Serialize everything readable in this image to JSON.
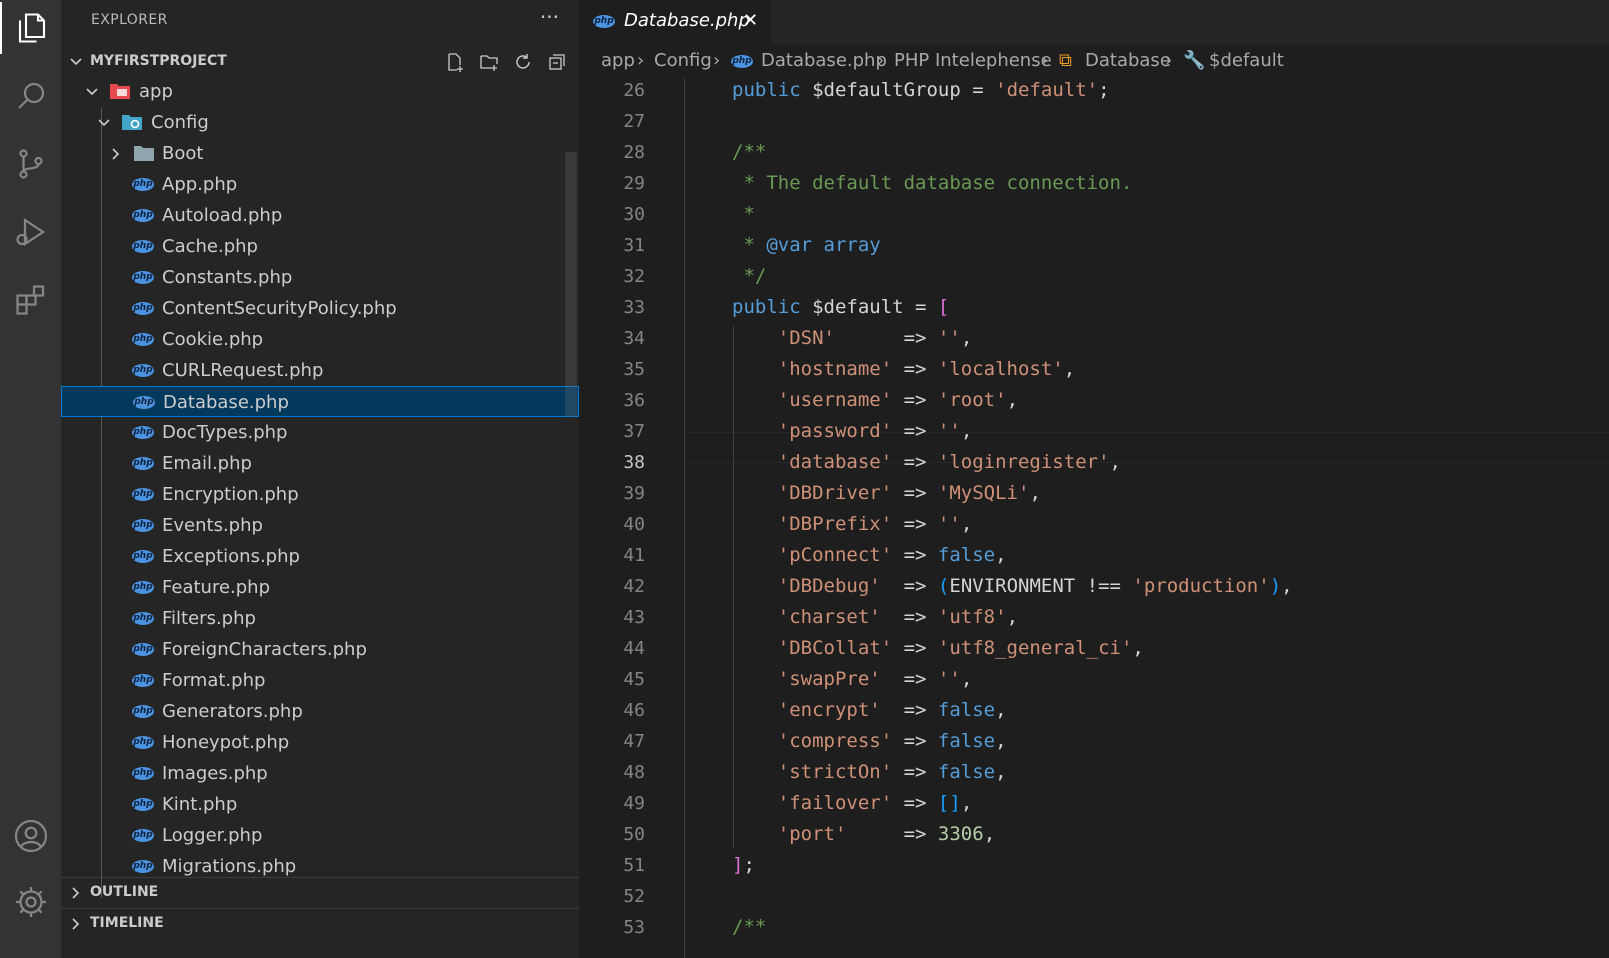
{
  "sidebar": {
    "title": "EXPLORER",
    "more": "···",
    "project": "MYFIRSTPROJECT",
    "tree": {
      "app": "app",
      "config": "Config",
      "boot": "Boot",
      "files": [
        "App.php",
        "Autoload.php",
        "Cache.php",
        "Constants.php",
        "ContentSecurityPolicy.php",
        "Cookie.php",
        "CURLRequest.php",
        "Database.php",
        "DocTypes.php",
        "Email.php",
        "Encryption.php",
        "Events.php",
        "Exceptions.php",
        "Feature.php",
        "Filters.php",
        "ForeignCharacters.php",
        "Format.php",
        "Generators.php",
        "Honeypot.php",
        "Images.php",
        "Kint.php",
        "Logger.php",
        "Migrations.php"
      ],
      "selected": "Database.php"
    },
    "outline": "OUTLINE",
    "timeline": "TIMELINE"
  },
  "tab": {
    "label": "Database.php",
    "close": "✕",
    "icon_text": "php"
  },
  "breadcrumb": [
    "app",
    "Config",
    "Database.php",
    "PHP Intelephense",
    "Database",
    "$default"
  ],
  "editor": {
    "line_numbers": [
      "26",
      "27",
      "28",
      "29",
      "30",
      "31",
      "32",
      "33",
      "34",
      "35",
      "36",
      "37",
      "38",
      "39",
      "40",
      "41",
      "42",
      "43",
      "44",
      "45",
      "46",
      "47",
      "48",
      "49",
      "50",
      "51",
      "52",
      "53"
    ],
    "active_line": "38",
    "code_lines": [
      [
        [
          "k",
          "public"
        ],
        [
          "v",
          " $defaultGroup"
        ],
        [
          "p",
          " = "
        ],
        [
          "s",
          "'default'"
        ],
        [
          "p",
          ";"
        ]
      ],
      [],
      [
        [
          "cm",
          "/**"
        ]
      ],
      [
        [
          "cm",
          " * The default database connection."
        ]
      ],
      [
        [
          "cm",
          " *"
        ]
      ],
      [
        [
          "cm",
          " * "
        ],
        [
          "tg",
          "@var"
        ],
        [
          "cm",
          " "
        ],
        [
          "k",
          "array"
        ]
      ],
      [
        [
          "cm",
          " */"
        ]
      ],
      [
        [
          "k",
          "public"
        ],
        [
          "v",
          " $default"
        ],
        [
          "p",
          " = "
        ],
        [
          "b1",
          "["
        ]
      ],
      [
        [
          "p",
          "    "
        ],
        [
          "s",
          "'DSN'"
        ],
        [
          "p",
          "      => "
        ],
        [
          "s",
          "''"
        ],
        [
          "p",
          ","
        ]
      ],
      [
        [
          "p",
          "    "
        ],
        [
          "s",
          "'hostname'"
        ],
        [
          "p",
          " => "
        ],
        [
          "s",
          "'localhost'"
        ],
        [
          "p",
          ","
        ]
      ],
      [
        [
          "p",
          "    "
        ],
        [
          "s",
          "'username'"
        ],
        [
          "p",
          " => "
        ],
        [
          "s",
          "'root'"
        ],
        [
          "p",
          ","
        ]
      ],
      [
        [
          "p",
          "    "
        ],
        [
          "s",
          "'password'"
        ],
        [
          "p",
          " => "
        ],
        [
          "s",
          "''"
        ],
        [
          "p",
          ","
        ]
      ],
      [
        [
          "p",
          "    "
        ],
        [
          "s",
          "'database'"
        ],
        [
          "p",
          " => "
        ],
        [
          "s",
          "'loginregister'"
        ],
        [
          "p",
          ","
        ]
      ],
      [
        [
          "p",
          "    "
        ],
        [
          "s",
          "'DBDriver'"
        ],
        [
          "p",
          " => "
        ],
        [
          "s",
          "'MySQLi'"
        ],
        [
          "p",
          ","
        ]
      ],
      [
        [
          "p",
          "    "
        ],
        [
          "s",
          "'DBPrefix'"
        ],
        [
          "p",
          " => "
        ],
        [
          "s",
          "''"
        ],
        [
          "p",
          ","
        ]
      ],
      [
        [
          "p",
          "    "
        ],
        [
          "s",
          "'pConnect'"
        ],
        [
          "p",
          " => "
        ],
        [
          "k",
          "false"
        ],
        [
          "p",
          ","
        ]
      ],
      [
        [
          "p",
          "    "
        ],
        [
          "s",
          "'DBDebug'"
        ],
        [
          "p",
          "  => "
        ],
        [
          "b2",
          "("
        ],
        [
          "v",
          "ENVIRONMENT !== "
        ],
        [
          "s",
          "'production'"
        ],
        [
          "b2",
          ")"
        ],
        [
          "p",
          ","
        ]
      ],
      [
        [
          "p",
          "    "
        ],
        [
          "s",
          "'charset'"
        ],
        [
          "p",
          "  => "
        ],
        [
          "s",
          "'utf8'"
        ],
        [
          "p",
          ","
        ]
      ],
      [
        [
          "p",
          "    "
        ],
        [
          "s",
          "'DBCollat'"
        ],
        [
          "p",
          " => "
        ],
        [
          "s",
          "'utf8_general_ci'"
        ],
        [
          "p",
          ","
        ]
      ],
      [
        [
          "p",
          "    "
        ],
        [
          "s",
          "'swapPre'"
        ],
        [
          "p",
          "  => "
        ],
        [
          "s",
          "''"
        ],
        [
          "p",
          ","
        ]
      ],
      [
        [
          "p",
          "    "
        ],
        [
          "s",
          "'encrypt'"
        ],
        [
          "p",
          "  => "
        ],
        [
          "k",
          "false"
        ],
        [
          "p",
          ","
        ]
      ],
      [
        [
          "p",
          "    "
        ],
        [
          "s",
          "'compress'"
        ],
        [
          "p",
          " => "
        ],
        [
          "k",
          "false"
        ],
        [
          "p",
          ","
        ]
      ],
      [
        [
          "p",
          "    "
        ],
        [
          "s",
          "'strictOn'"
        ],
        [
          "p",
          " => "
        ],
        [
          "k",
          "false"
        ],
        [
          "p",
          ","
        ]
      ],
      [
        [
          "p",
          "    "
        ],
        [
          "s",
          "'failover'"
        ],
        [
          "p",
          " => "
        ],
        [
          "b2",
          "[]"
        ],
        [
          "p",
          ","
        ]
      ],
      [
        [
          "p",
          "    "
        ],
        [
          "s",
          "'port'"
        ],
        [
          "p",
          "     => "
        ],
        [
          "n",
          "3306"
        ],
        [
          "p",
          ","
        ]
      ],
      [
        [
          "b1",
          "]"
        ],
        [
          "p",
          ";"
        ]
      ],
      [],
      [
        [
          "cm",
          "/**"
        ]
      ]
    ]
  },
  "colors": {
    "accent": "#0078d4",
    "selection": "#04395e",
    "php_icon": "#4b93e0"
  }
}
